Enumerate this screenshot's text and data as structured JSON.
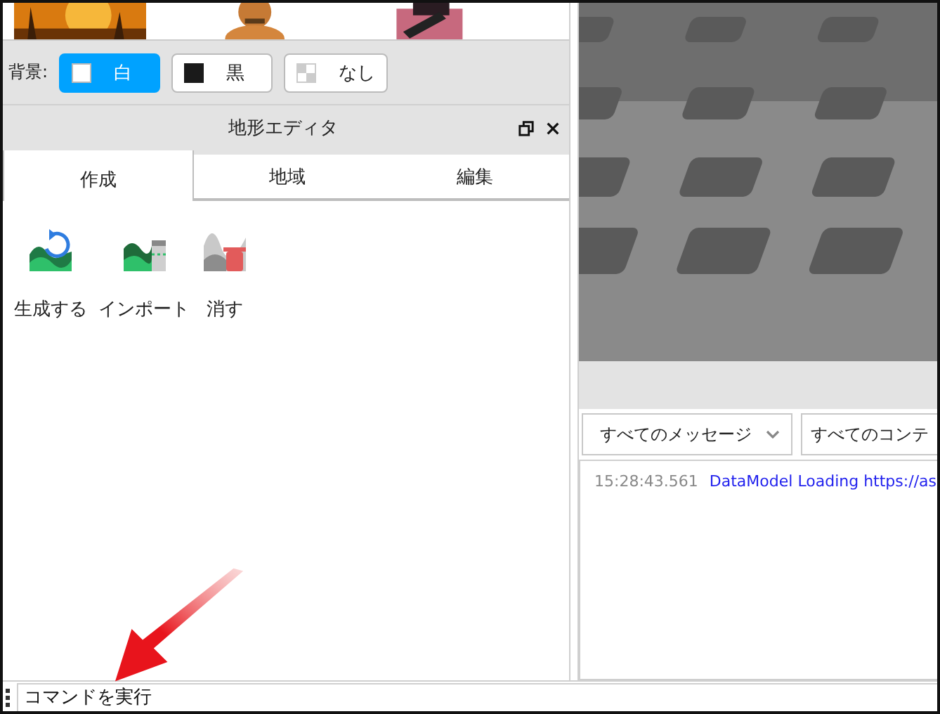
{
  "background": {
    "label": "背景:",
    "options": [
      {
        "label": "白",
        "kind": "white",
        "selected": true
      },
      {
        "label": "黒",
        "kind": "black",
        "selected": false
      },
      {
        "label": "なし",
        "kind": "none",
        "selected": false
      }
    ]
  },
  "panel": {
    "title": "地形エディタ",
    "tabs": [
      {
        "label": "作成",
        "selected": true
      },
      {
        "label": "地域",
        "selected": false
      },
      {
        "label": "編集",
        "selected": false
      }
    ],
    "tools": [
      {
        "label": "生成する",
        "kind": "generate"
      },
      {
        "label": "インポート",
        "kind": "import"
      },
      {
        "label": "消す",
        "kind": "clear"
      }
    ]
  },
  "output": {
    "filters": [
      {
        "label": "すべてのメッセージ",
        "kind": "dropdown"
      },
      {
        "label": "すべてのコンテ",
        "kind": "plain"
      }
    ],
    "messages": [
      {
        "time": "15:28:43.561",
        "text": "DataModel Loading https://as"
      }
    ]
  },
  "command_bar": {
    "placeholder": "コマンドを実行"
  }
}
